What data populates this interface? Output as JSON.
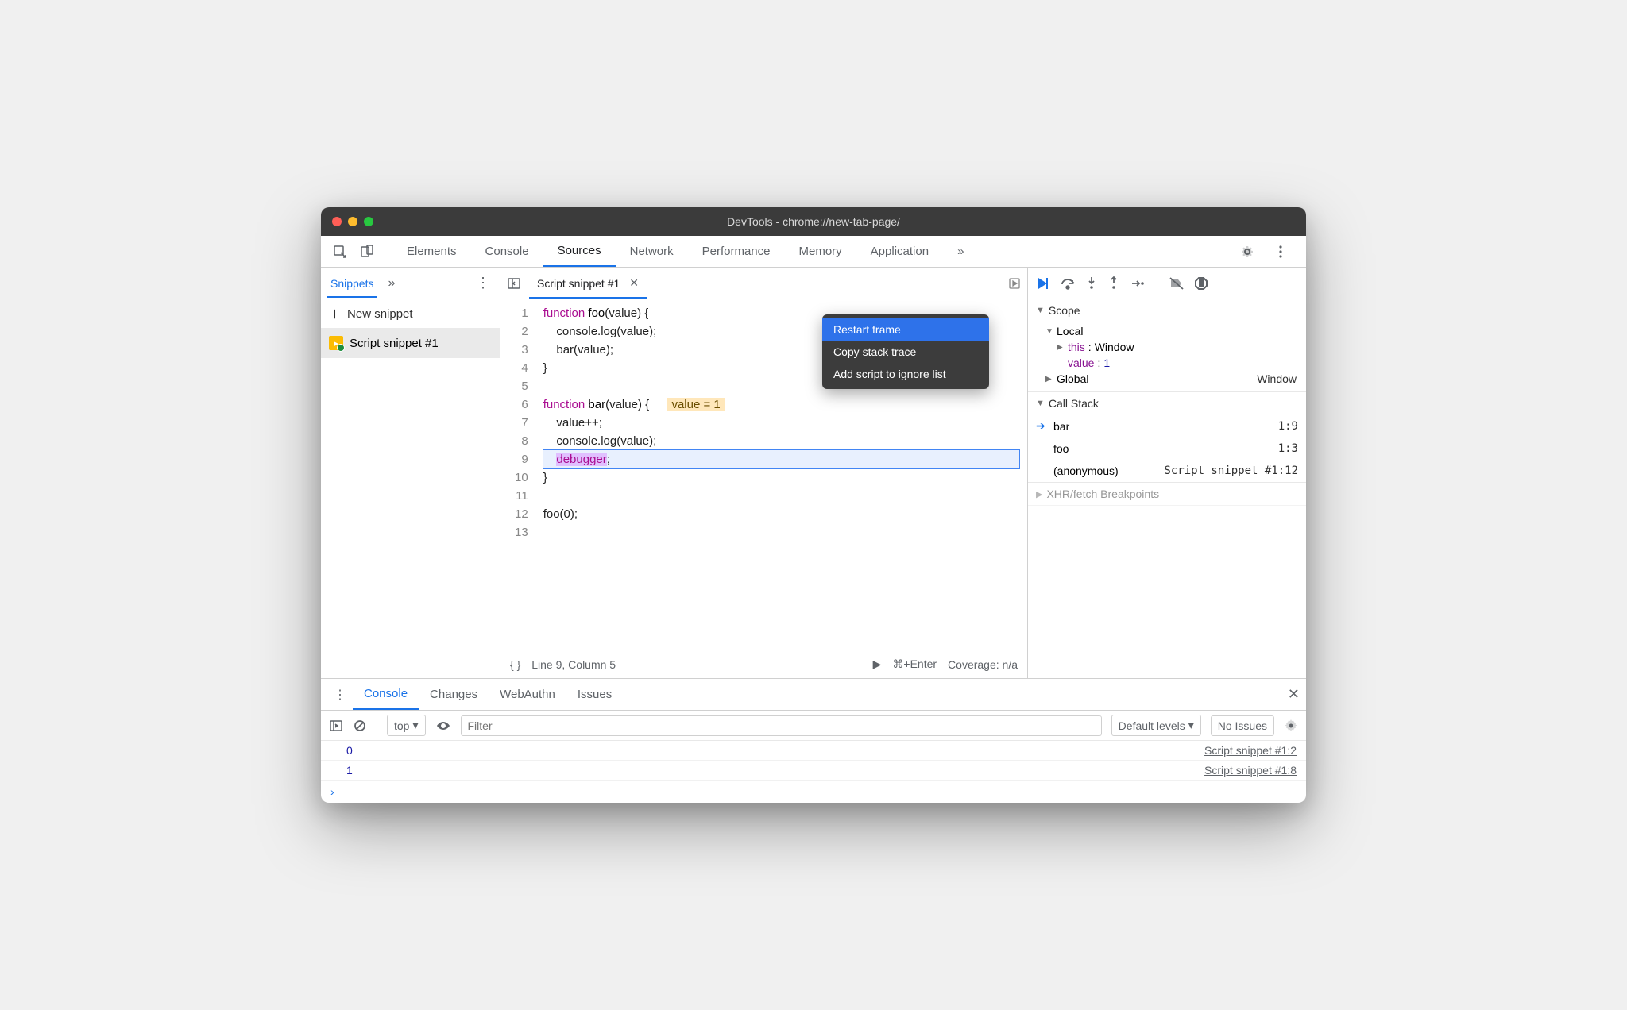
{
  "window": {
    "title": "DevTools - chrome://new-tab-page/"
  },
  "main_tabs": {
    "items": [
      "Elements",
      "Console",
      "Sources",
      "Network",
      "Performance",
      "Memory",
      "Application"
    ],
    "active": "Sources"
  },
  "sidebar": {
    "tab_label": "Snippets",
    "new_snippet": "New snippet",
    "items": [
      {
        "label": "Script snippet #1"
      }
    ]
  },
  "editor": {
    "filename": "Script snippet #1",
    "lines": [
      "function foo(value) {",
      "    console.log(value);",
      "    bar(value);",
      "}",
      "",
      "function bar(value) {",
      "    value++;",
      "    console.log(value);",
      "    debugger;",
      "}",
      "",
      "foo(0);",
      ""
    ],
    "inline_hint": "value = 1",
    "current_line": 9,
    "footer": {
      "pos": "Line 9, Column 5",
      "run_hint": "⌘+Enter",
      "coverage": "Coverage: n/a"
    }
  },
  "debugger": {
    "scope": {
      "title": "Scope",
      "local_label": "Local",
      "this_label": "this",
      "this_value": "Window",
      "value_label": "value",
      "value_value": "1",
      "global_label": "Global",
      "global_value": "Window"
    },
    "callstack": {
      "title": "Call Stack",
      "frames": [
        {
          "name": "bar",
          "loc": "1:9",
          "current": true
        },
        {
          "name": "foo",
          "loc": "1:3"
        },
        {
          "name": "(anonymous)",
          "loc": "Script snippet #1:12"
        }
      ]
    },
    "xhr_title": "XHR/fetch Breakpoints"
  },
  "context_menu": {
    "items": [
      "Restart frame",
      "Copy stack trace",
      "Add script to ignore list"
    ],
    "selected": 0
  },
  "drawer": {
    "tabs": [
      "Console",
      "Changes",
      "WebAuthn",
      "Issues"
    ],
    "active": "Console",
    "toolbar": {
      "context": "top",
      "filter_placeholder": "Filter",
      "levels": "Default levels",
      "issues": "No Issues"
    },
    "console": {
      "rows": [
        {
          "value": "0",
          "src": "Script snippet #1:2"
        },
        {
          "value": "1",
          "src": "Script snippet #1:8"
        }
      ]
    }
  }
}
